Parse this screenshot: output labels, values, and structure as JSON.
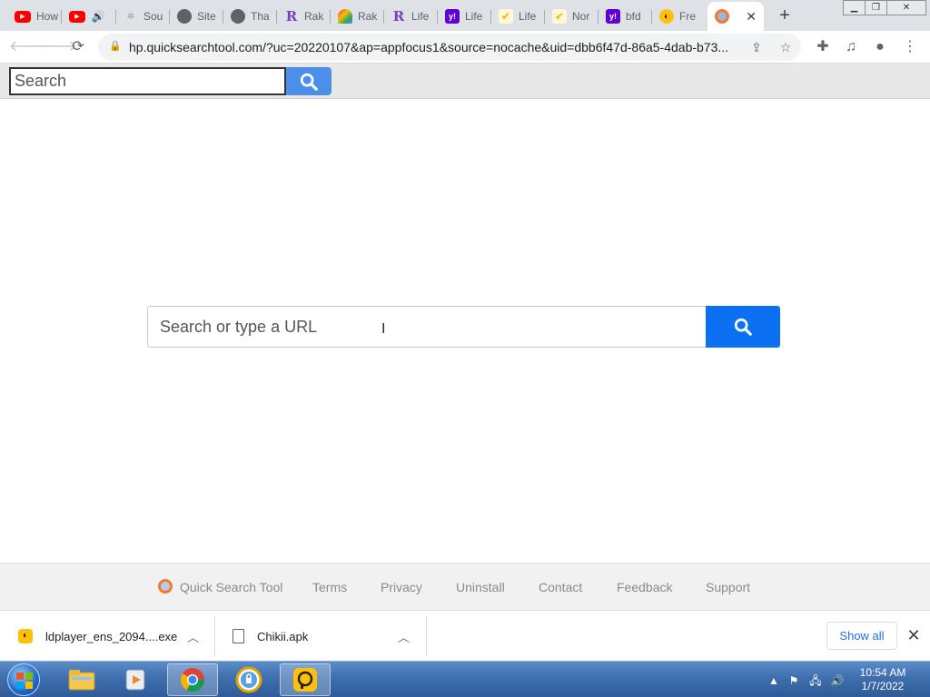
{
  "tabs": [
    {
      "title": "How",
      "icon": "youtube-icon"
    },
    {
      "title": "",
      "icon": "youtube-audio-icon"
    },
    {
      "title": "Sou",
      "icon": "star-icon"
    },
    {
      "title": "Site",
      "icon": "globe-icon"
    },
    {
      "title": "Tha",
      "icon": "globe-icon"
    },
    {
      "title": "Rak",
      "icon": "rakuten-r-icon"
    },
    {
      "title": "Rak",
      "icon": "rainbow-icon"
    },
    {
      "title": "Life",
      "icon": "rakuten-r-icon"
    },
    {
      "title": "Life",
      "icon": "yahoo-icon"
    },
    {
      "title": "Life",
      "icon": "check-icon"
    },
    {
      "title": "Nor",
      "icon": "check-icon"
    },
    {
      "title": "bfd",
      "icon": "yahoo-icon"
    },
    {
      "title": "Fre",
      "icon": "ldplayer-icon"
    },
    {
      "title": "",
      "icon": "quick-search-icon",
      "active": true
    }
  ],
  "favicon_text": {
    "youtube": "▶",
    "rakuten": "R",
    "yahoo": "y!",
    "check": "✔",
    "ldplayer": "◐"
  },
  "omnibox": {
    "url": "hp.quicksearchtool.com/?uc=20220107&ap=appfocus1&source=nocache&uid=dbb6f47d-86a5-4dab-b73..."
  },
  "top_search": {
    "placeholder": "Search"
  },
  "main_search": {
    "placeholder": "Search or type a URL"
  },
  "footer": {
    "brand": "Quick Search Tool",
    "links": [
      "Terms",
      "Privacy",
      "Uninstall",
      "Contact",
      "Feedback",
      "Support"
    ]
  },
  "downloads": [
    {
      "name": "ldplayer_ens_2094....exe"
    },
    {
      "name": "Chikii.apk"
    }
  ],
  "shelf": {
    "show_all": "Show all"
  },
  "clock": {
    "time": "10:54 AM",
    "date": "1/7/2022"
  },
  "colors": {
    "accent": "#0b71f2",
    "top_search_button": "#4c8fe8",
    "footer_bg": "#f1f1f1"
  }
}
